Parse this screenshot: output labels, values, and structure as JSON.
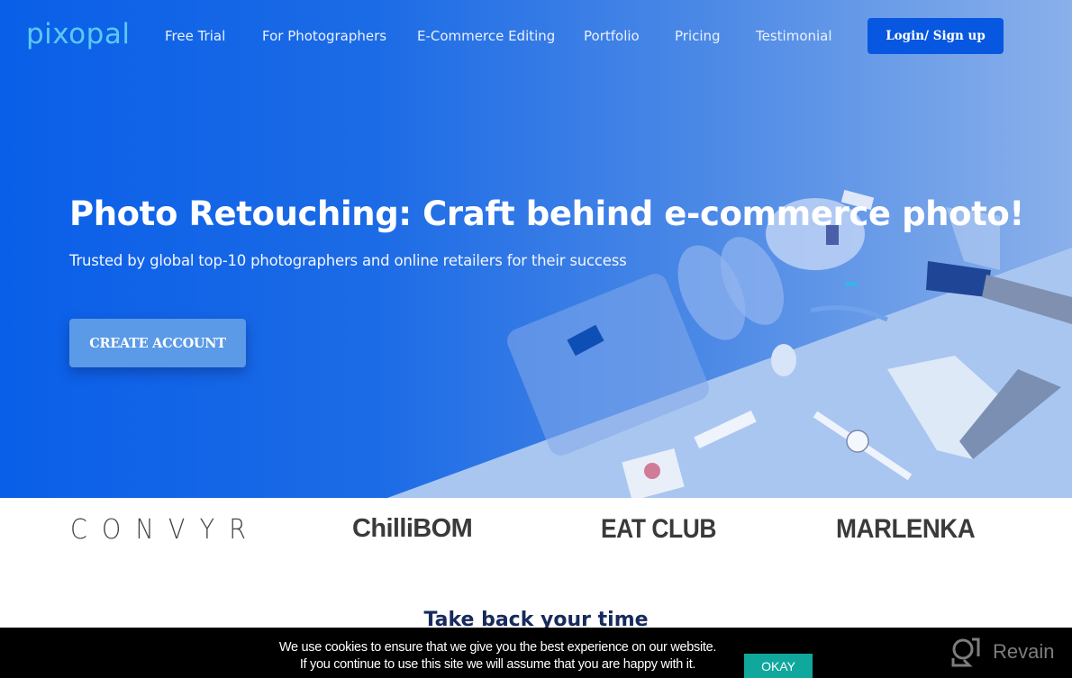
{
  "nav": {
    "logo": "pixopal",
    "links": [
      "Free Trial",
      "For Photographers",
      "E-Commerce Editing",
      "Portfolio",
      "Pricing",
      "Testimonial"
    ],
    "login_label": "Login/ Sign up"
  },
  "hero": {
    "title": "Photo Retouching: Craft behind e-commerce photo!",
    "subtitle": "Trusted by global top-10 photographers and online retailers for their success",
    "cta_label": "CREATE ACCOUNT"
  },
  "brands": [
    "CONVYR",
    "ChilliBOM",
    "EAT CLUB",
    "MARLENKA"
  ],
  "section": {
    "title": "Take back your time"
  },
  "cookie": {
    "line1": "We use cookies to ensure that we give you the best experience on our website.",
    "line2": "If you continue to use this site we will assume that you are happy with it.",
    "okay_label": "OKAY"
  },
  "watermark": {
    "text": "Revain"
  },
  "colors": {
    "brand_blue": "#0757e0",
    "logo_cyan": "#5cc9f5",
    "okay_teal": "#10a79d",
    "heading_navy": "#162a5c"
  }
}
